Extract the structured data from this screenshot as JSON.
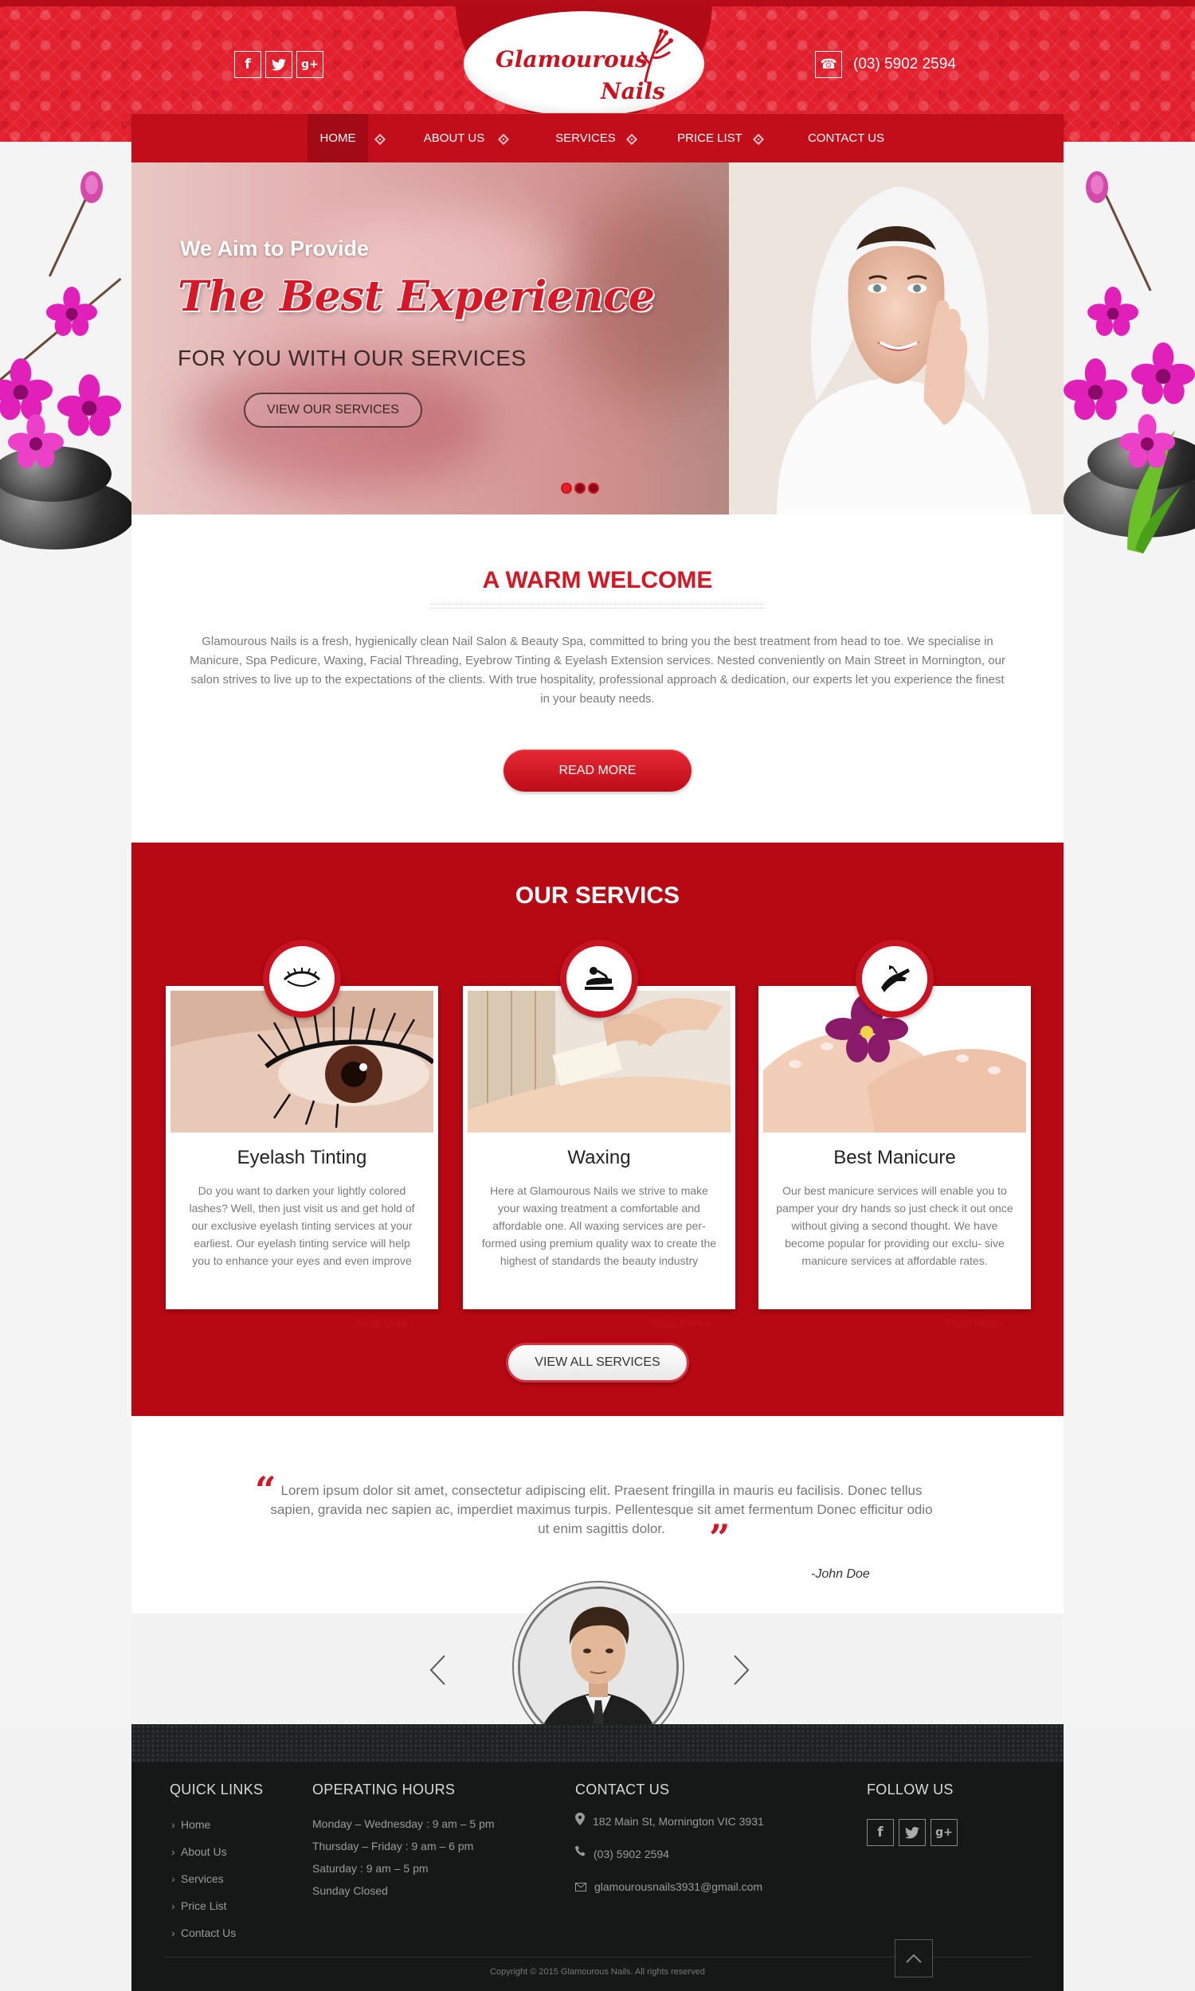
{
  "header": {
    "brand_line1": "Glamourous",
    "brand_line2": "Nails",
    "phone": "(03) 5902 2594",
    "social_icons": [
      "facebook-icon",
      "twitter-icon",
      "google-plus-icon"
    ]
  },
  "nav": {
    "items": [
      {
        "label": "HOME",
        "active": true
      },
      {
        "label": "ABOUT US",
        "active": false
      },
      {
        "label": "SERVICES",
        "active": false
      },
      {
        "label": "PRICE LIST",
        "active": false
      },
      {
        "label": "CONTACT US",
        "active": false
      }
    ]
  },
  "hero": {
    "line1": "We Aim to Provide",
    "title": "The Best Experience",
    "line2": "FOR YOU WITH OUR SERVICES",
    "button": "VIEW OUR SERVICES",
    "slides": 3,
    "active_slide": 1
  },
  "welcome": {
    "title": "A WARM WELCOME",
    "text": "Glamourous Nails is a fresh, hygienically clean Nail Salon & Beauty Spa, committed to bring you the best treatment from head to toe. We specialise in Manicure, Spa Pedicure, Waxing, Facial Threading, Eyebrow Tinting & Eyelash Extension services. Nested conveniently on Main Street in Mornington, our salon strives to live up to the expectations of the clients. With true hospitality, professional approach & dedication, our experts let you experience the finest in your beauty needs.",
    "button": "READ MORE"
  },
  "services": {
    "title": "OUR SERVICS",
    "cards": [
      {
        "title": "Eyelash Tinting",
        "icon": "eyelash-icon",
        "text": "Do you want to darken your lightly colored lashes? Well, then just visit us and get hold of our exclusive eyelash tinting services at your earliest. Our eyelash tinting service will help you to enhance your eyes and even improve",
        "link": "Read More ›"
      },
      {
        "title": "Waxing",
        "icon": "massage-icon",
        "text": "Here at Glamourous Nails we strive to make your waxing treatment a comfortable and affordable one. All waxing services are per- formed using premium quality wax to create the highest of standards the beauty industry",
        "link": "Read More ›"
      },
      {
        "title": "Best Manicure",
        "icon": "manicure-hand-icon",
        "text": "Our best manicure services will enable you to pamper your dry hands so just check it out once without giving a second thought. We have become popular for providing our exclu- sive manicure services at affordable rates.",
        "link": "Read More ›"
      }
    ],
    "button": "VIEW ALL SERVICES"
  },
  "testimonial": {
    "quote": "Lorem ipsum dolor sit amet, consectetur adipiscing elit. Praesent fringilla in mauris eu facilisis. Donec tellus sapien, gravida nec sapien ac, imperdiet maximus turpis. Pellentesque sit amet fermentum Donec efficitur odio ut enim sagittis  dolor.",
    "author": "-John Doe"
  },
  "footer": {
    "quick_links_title": "QUICK LINKS",
    "quick_links": [
      "Home",
      "About Us",
      "Services",
      "Price List",
      "Contact Us"
    ],
    "hours_title": "OPERATING HOURS",
    "hours": [
      "Monday – Wednesday : 9 am – 5 pm",
      "Thursday – Friday : 9 am – 6 pm",
      "Saturday : 9 am – 5 pm",
      "Sunday Closed"
    ],
    "contact_title": "CONTACT US",
    "address": "182 Main St, Mornington VIC 3931",
    "phone": "(03) 5902 2594",
    "email": "glamourousnails3931@gmail.com",
    "follow_title": "FOLLOW US",
    "copyright": "Copyright © 2015 Glamourous Nails. All rights reserved"
  },
  "colors": {
    "accent": "#c20d1a",
    "accent_dark": "#b70913",
    "footer_bg": "#161818"
  }
}
